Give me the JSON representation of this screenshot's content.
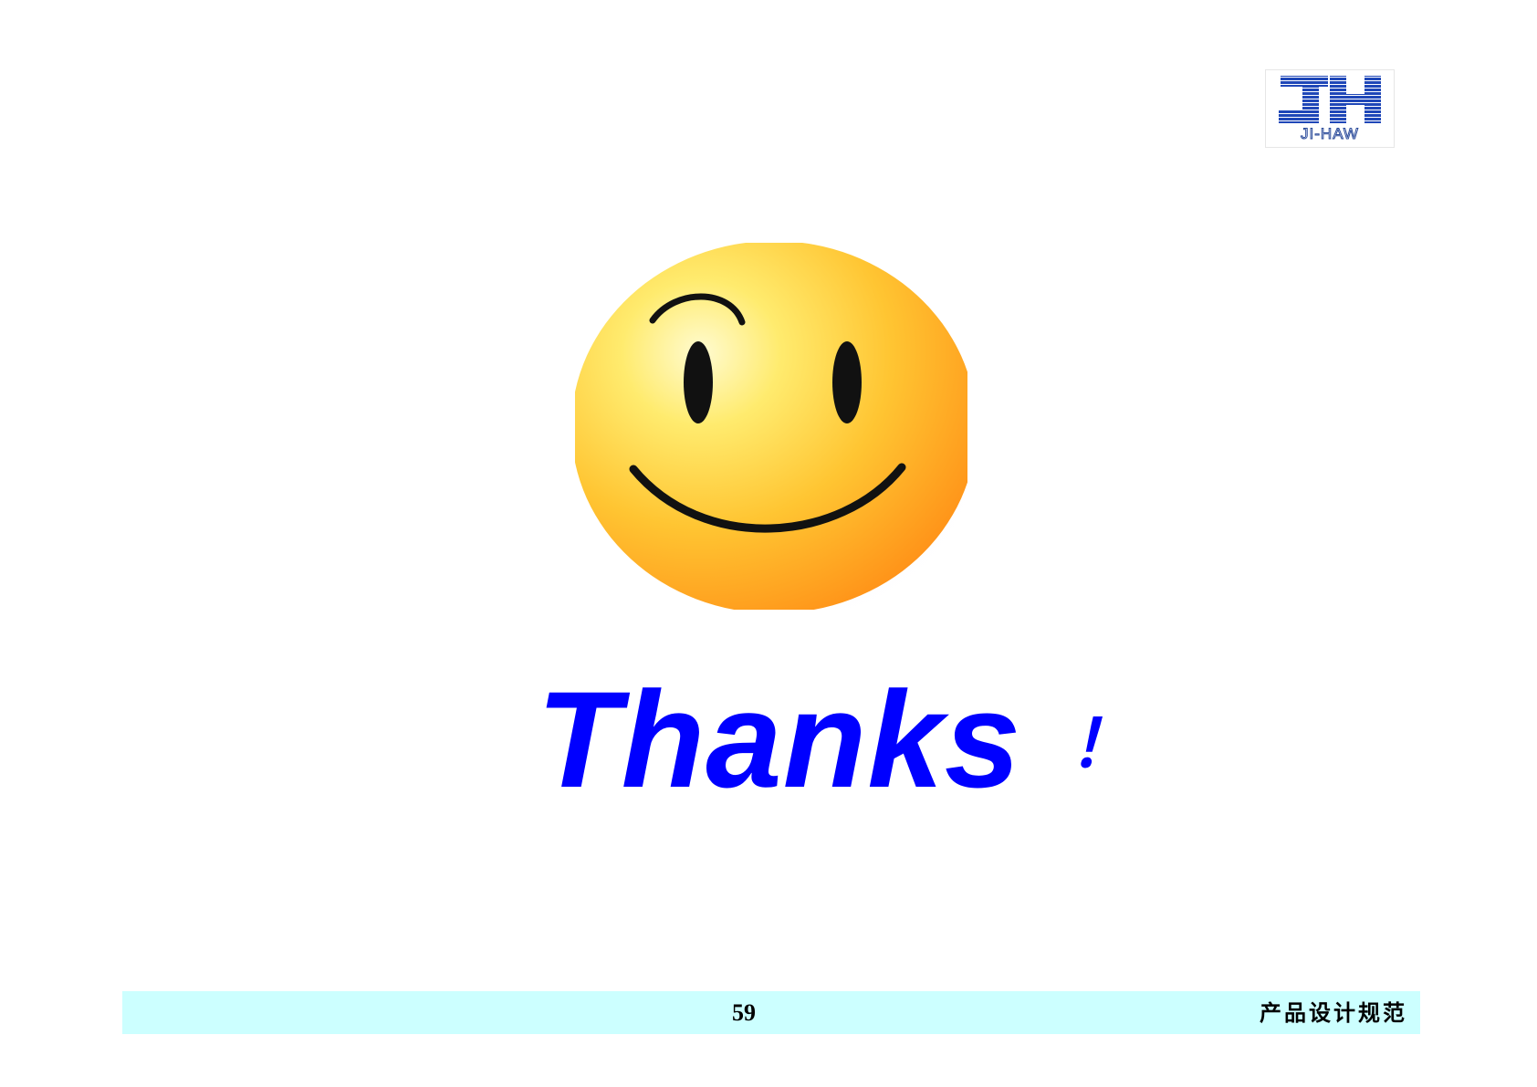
{
  "logo": {
    "monogram": "JH",
    "wordmark": "JI-HAW",
    "color": "#1f47b8"
  },
  "illustration": {
    "icon": "smiley-face-icon",
    "face_color_light": "#fff7a8",
    "face_color_mid": "#ffd23a",
    "face_color_dark": "#ff9c1a",
    "feature_color": "#111111"
  },
  "headline": {
    "text": "Thanks",
    "punctuation": "！",
    "color": "#0000ff"
  },
  "footer": {
    "page_number": "59",
    "title": "产品设计规范",
    "background": "#ccffff"
  }
}
